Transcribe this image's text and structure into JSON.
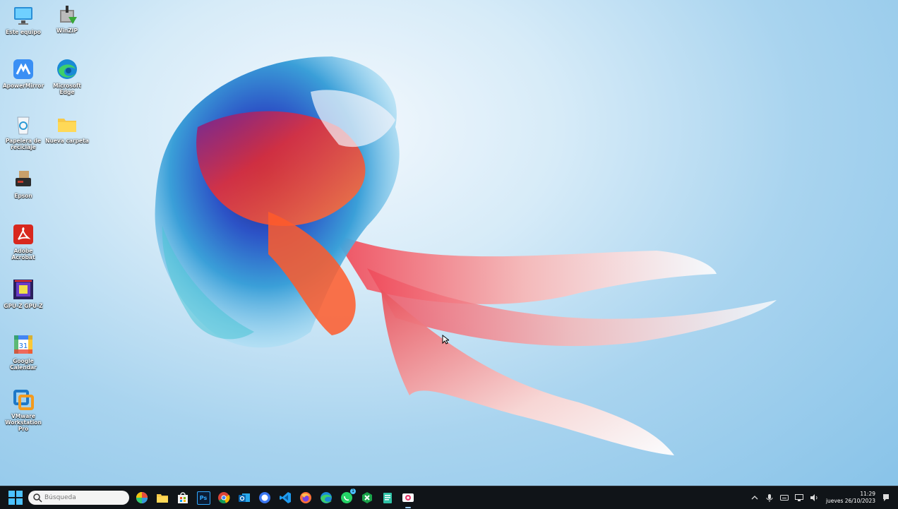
{
  "desktop": {
    "icons": [
      {
        "label": "Este equipo",
        "icon": "monitor-icon"
      },
      {
        "label": "WinZIP",
        "icon": "winzip-icon"
      },
      {
        "label": "ApowerMirror",
        "icon": "apowermirror-icon"
      },
      {
        "label": "Microsoft Edge",
        "icon": "edge-icon"
      },
      {
        "label": "Papelera de reciclaje",
        "icon": "recycle-bin-icon"
      },
      {
        "label": "Nueva carpeta",
        "icon": "folder-icon"
      },
      {
        "label": "Epson",
        "icon": "epson-icon"
      },
      {
        "label": "Adobe Acrobat",
        "icon": "acrobat-icon"
      },
      {
        "label": "GPU-Z GPU-Z",
        "icon": "gpuz-icon"
      },
      {
        "label": "Google Calendar",
        "icon": "google-calendar-icon"
      },
      {
        "label": "VMware Workstation Pro",
        "icon": "vmware-icon"
      }
    ],
    "calendar_day": "31"
  },
  "taskbar": {
    "search_placeholder": "Búsqueda",
    "apps": [
      {
        "name": "pinwheel-app-icon"
      },
      {
        "name": "file-explorer-icon"
      },
      {
        "name": "microsoft-store-icon"
      },
      {
        "name": "photoshop-icon",
        "text": "Ps"
      },
      {
        "name": "chrome-icon"
      },
      {
        "name": "outlook-icon"
      },
      {
        "name": "signal-icon"
      },
      {
        "name": "vscode-icon"
      },
      {
        "name": "firefox-icon"
      },
      {
        "name": "edge-icon"
      },
      {
        "name": "whatsapp-icon",
        "badge": "1"
      },
      {
        "name": "green-app-icon"
      },
      {
        "name": "notepad-icon"
      },
      {
        "name": "snipping-tool-icon"
      }
    ],
    "tray": {
      "time": "11:29",
      "date": "jueves 26/10/2023"
    }
  },
  "colors": {
    "taskbar_bg": "#101418",
    "accent": "#4cc2ff"
  }
}
